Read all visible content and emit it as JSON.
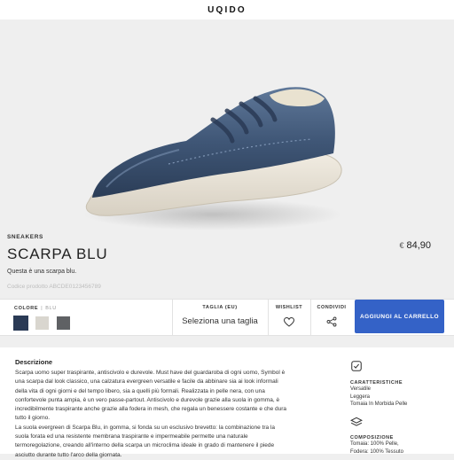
{
  "header": {
    "logo": "UQIDO"
  },
  "product": {
    "category": "SNEAKERS",
    "name": "SCARPA BLU",
    "price_currency": "€",
    "price_value": "84,90",
    "short_description": "Questa è una scarpa blu.",
    "code": "Codice prodotto ABCDE0123456789"
  },
  "colors": {
    "label": "COLORE",
    "separator": "|",
    "selected": "BLU",
    "swatches": [
      {
        "name": "blu",
        "hex": "#2a3a55"
      },
      {
        "name": "bianco",
        "hex": "#d9d6cf"
      },
      {
        "name": "grigio",
        "hex": "#5f6164"
      }
    ]
  },
  "size": {
    "label": "TAGLIA (EU)",
    "value": "Seleziona una taglia"
  },
  "wishlist": {
    "label": "WISHLIST"
  },
  "share": {
    "label": "CONDIVIDI"
  },
  "cart": {
    "label": "AGGIUNGI AL CARRELLO",
    "color": "#3462c7"
  },
  "description": {
    "title": "Descrizione",
    "paragraphs": [
      "Scarpa uomo super traspirante, antiscivolo e durevole. Must have del guardaroba di ogni uomo, Symbol è una scarpa dal look classico, una calzatura evergreen versatile e facile da abbinare sia ai look informali della vita di ogni giorni e del tempo libero, sia a quelli più formali. Realizzata in pelle nera, con una confortevole punta ampia, è un vero passe-partout. Antiscivolo e durevole grazie alla suola in gomma, è incredibilmente traspirante anche grazie alla fodera in mesh, che regala un benessere costante e che dura tutto il giorno.",
      "La suola evergreen di Scarpa Blu, in gomma, si fonda su un esclusivo brevetto: la combinazione tra la suola forata ed una resistente membrana traspirante e impermeabile permette una naturale termoregolazione, creando all'interno della scarpa un microclima ideale in grado di mantenere il piede asciutto durante tutto l'arco della giornata."
    ]
  },
  "features": {
    "title": "CARATTERISTICHE",
    "items": [
      "Versatile",
      "Leggera",
      "Tomaia In Morbida Pelle"
    ]
  },
  "composition": {
    "title": "COMPOSIZIONE",
    "items": [
      "Tomaia: 100% Pelle,",
      "Fodera: 100% Tessuto"
    ]
  }
}
